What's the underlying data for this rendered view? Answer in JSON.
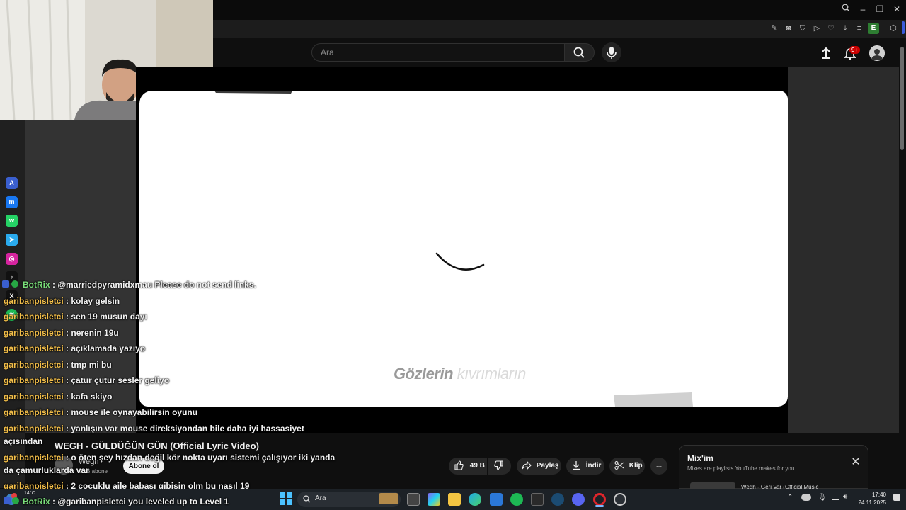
{
  "search": {
    "placeholder": "Ara"
  },
  "notifications": {
    "badge": "9+"
  },
  "video": {
    "lyric_word1": "Gözlerin",
    "lyric_word2": "kıvrımların",
    "title": "WEGH - GÜLDÜĞÜN GÜN (Official Lyric Video)"
  },
  "channel": {
    "name": "Wegh",
    "subscribers": "22 B abone",
    "subscribe_label": "Abone ol"
  },
  "actions": {
    "likes": "49 B",
    "share": "Paylaş",
    "download": "İndir",
    "clip": "Klip",
    "more": "..."
  },
  "chat": [
    {
      "user": "BotRix",
      "message": "@marriedpyramidxmau Please do not send links.",
      "bot": true
    },
    {
      "user": "garibanpisletci",
      "message": "kolay gelsin"
    },
    {
      "user": "garibanpisletci",
      "message": "sen 19 musun dayı"
    },
    {
      "user": "garibanpisletci",
      "message": "nerenin 19u"
    },
    {
      "user": "garibanpisletci",
      "message": "açıklamada yazıyo"
    },
    {
      "user": "garibanpisletci",
      "message": "tmp mi bu"
    },
    {
      "user": "garibanpisletci",
      "message": "çatur çutur sesler geliyo"
    },
    {
      "user": "garibanpisletci",
      "message": "kafa skiyo"
    },
    {
      "user": "garibanpisletci",
      "message": "mouse ile oynayabilirsin oyunu"
    },
    {
      "user": "garibanpisletci",
      "message": "yanlışın var mouse direksiyondan bile daha iyi hassasiyet",
      "cont": "açısından"
    },
    {
      "user": "garibanpisletci",
      "message": "o öten şey hızdan değil kör nokta uyarı sistemi çalışıyor iki yanda",
      "cont": "da çamurluklarda var"
    },
    {
      "user": "garibanpisletci",
      "message": "2 çocuklu aile babası gibisin olm bu nasıl 19"
    },
    {
      "user": "BotRix",
      "message": "@garibanpisletci you leveled up to Level 1",
      "bot": true
    }
  ],
  "mix": {
    "title": "Mix'im",
    "subtitle": "Mixes are playlists YouTube makes for you",
    "first_item": "Wegh - Geri Var (Official Music"
  },
  "taskbar": {
    "search_label": "Ara",
    "weather": "14°C",
    "time": "17:40",
    "date": "24.11.2025"
  },
  "colors": {
    "chat_user": "#f5c04a",
    "bot_user": "#7be07b",
    "subscribe_bg": "#f1f1f1",
    "notification_badge": "#cc0000"
  }
}
